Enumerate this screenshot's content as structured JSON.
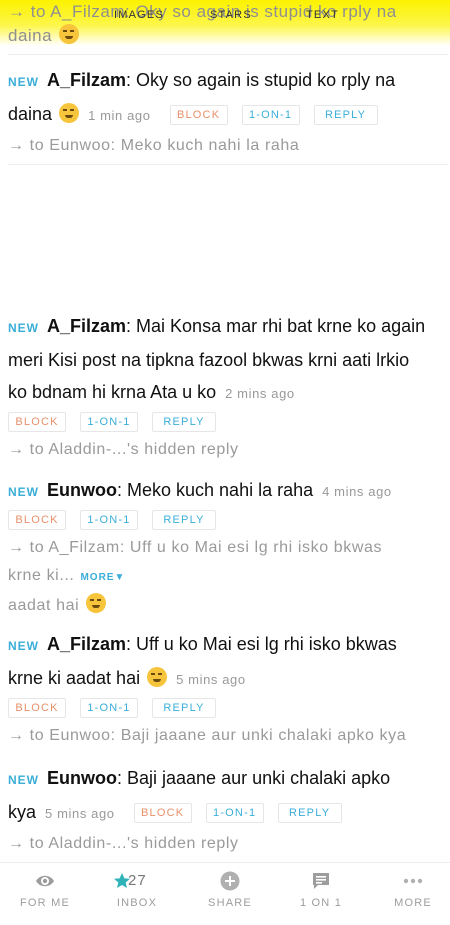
{
  "top": {
    "ghost_line1": "→ to A_Filzam: Oky so again is stupid ko rply na",
    "ghost_line2": "daina",
    "tabs": {
      "images": "IMAGES",
      "stars": "STARS",
      "text": "TEXT"
    }
  },
  "labels": {
    "new": "NEW",
    "block": "BLOCK",
    "one_on_one": "1-ON-1",
    "reply": "REPLY",
    "more": "MORE▼"
  },
  "posts": [
    {
      "author": "A_Filzam",
      "text1": ": Oky so again is stupid ko rply na",
      "text2": "daina",
      "time": "1 min ago",
      "reply_to": "→ to Eunwoo: Meko kuch nahi la raha"
    },
    {
      "author": "A_Filzam",
      "text1": ": Mai Konsa mar rhi bat krne ko again",
      "text2": "meri Kisi post na tipkna fazool bkwas krni aati lrkio",
      "text3": "ko bdnam hi krna Ata u ko",
      "time": "2 mins ago",
      "reply_to": "→ to Aladdin-...'s hidden reply"
    },
    {
      "author": "Eunwoo",
      "text1": ": Meko kuch nahi la raha",
      "time": "4 mins ago",
      "reply_to1": "→ to A_Filzam: Uff u ko Mai esi lg rhi isko bkwas",
      "reply_to2": "krne ki...",
      "reply_to3": "aadat hai"
    },
    {
      "author": "A_Filzam",
      "text1": ": Uff u ko Mai esi lg rhi isko bkwas",
      "text2": "krne ki aadat hai",
      "time": "5 mins ago",
      "reply_to": "→ to Eunwoo: Baji jaaane aur unki chalaki apko kya"
    },
    {
      "author": "Eunwoo",
      "text1": ": Baji jaaane aur unki chalaki apko",
      "text2": "kya",
      "time": "5 mins ago",
      "reply_to": "→ to Aladdin-...'s hidden reply"
    }
  ],
  "nav": {
    "for_me": "FOR ME",
    "inbox": "INBOX",
    "inbox_count": "27",
    "share": "SHARE",
    "one_on_one": "1 ON 1",
    "more": "MORE"
  }
}
